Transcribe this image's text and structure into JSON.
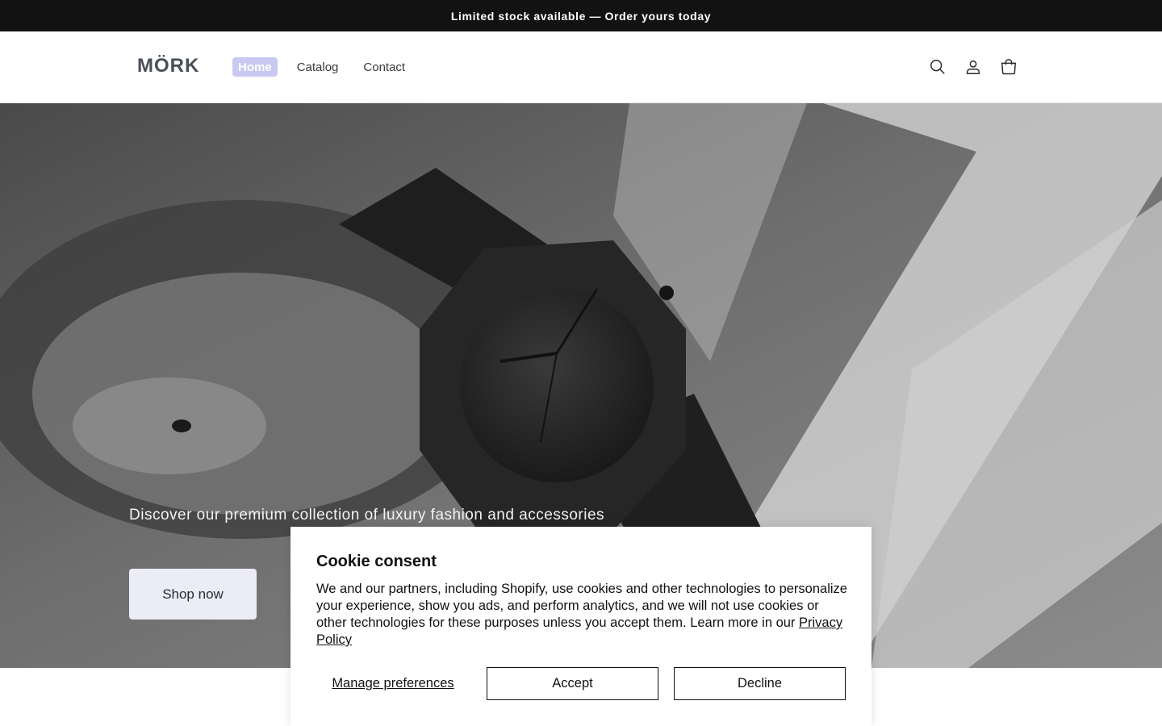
{
  "announcement": {
    "text": "Limited stock available — Order yours today"
  },
  "header": {
    "logo": "MÖRK",
    "nav": [
      {
        "label": "Home",
        "active": true
      },
      {
        "label": "Catalog",
        "active": false
      },
      {
        "label": "Contact",
        "active": false
      }
    ],
    "icons": [
      "search-icon",
      "account-icon",
      "cart-icon"
    ]
  },
  "hero": {
    "subtitle": "Discover our premium collection of luxury fashion and accessories",
    "cta": "Shop now"
  },
  "cookie": {
    "title": "Cookie consent",
    "body": "We and our partners, including Shopify, use cookies and other technologies to personalize your experience, show you ads, and perform analytics, and we will not use cookies or other technologies for these purposes unless you accept them. Learn more in our ",
    "privacy_link": "Privacy Policy",
    "manage": "Manage preferences",
    "accept": "Accept",
    "decline": "Decline"
  },
  "colors": {
    "announcement_bg": "#121212",
    "nav_active_bg": "#c9c9f2",
    "cta_bg": "#ececf6"
  }
}
